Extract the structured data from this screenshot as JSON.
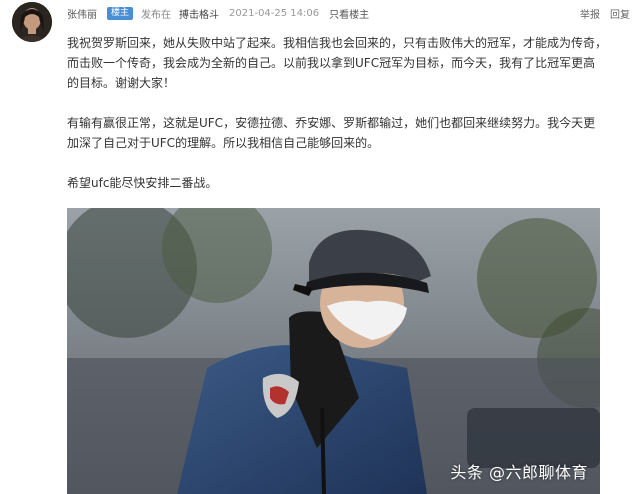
{
  "post": {
    "author": "张伟丽",
    "badge": "楼主",
    "posted_in_label": "发布在",
    "section": "搏击格斗",
    "timestamp": "2021-04-25 14:06",
    "only_op_label": "只看楼主",
    "actions": {
      "report": "举报",
      "reply": "回复"
    },
    "paragraphs": [
      "我祝贺罗斯回来，她从失败中站了起来。我相信我也会回来的，只有击败伟大的冠军，才能成为传奇，而击败一个传奇，我会成为全新的自己。以前我以拿到UFC冠军为目标，而今天，我有了比冠军更高的目标。谢谢大家！",
      "有输有赢很正常，这就是UFC，安德拉德、乔安娜、罗斯都输过，她们也都回来继续努力。我今天更加深了自己对于UFC的理解。所以我相信自己能够回来的。",
      "希望ufc能尽快安排二番战。"
    ],
    "image_watermark": "头条 @六郎聊体育"
  }
}
